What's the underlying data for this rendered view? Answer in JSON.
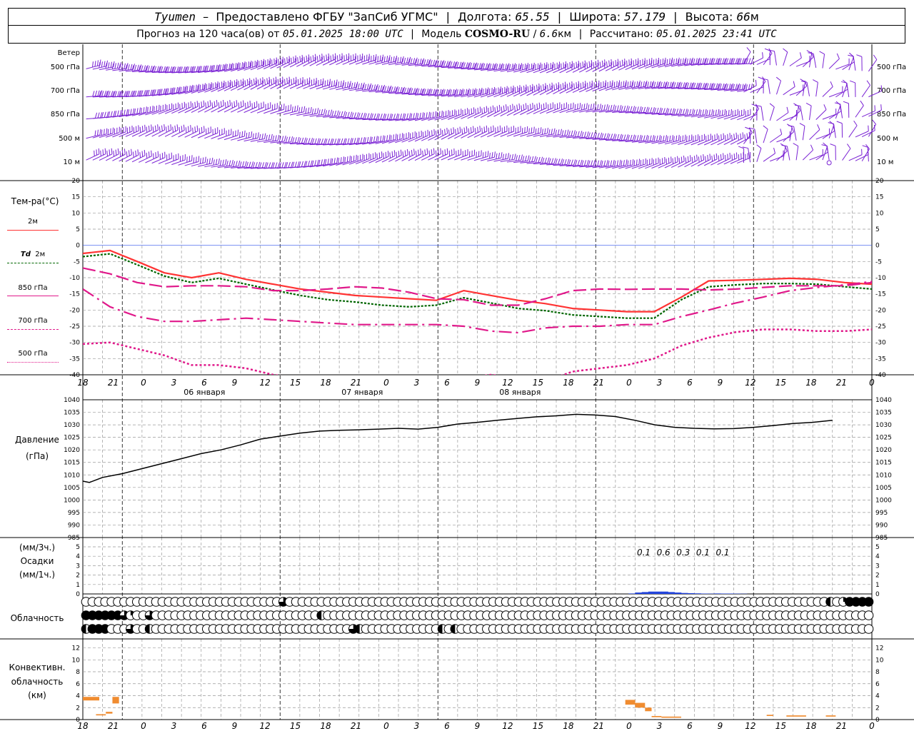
{
  "header": {
    "station": "Tyumen",
    "provider": "Предоставлено ФГБУ \"ЗапСиб УГМС\"",
    "lon_label": "Долгота:",
    "lon": "65.55",
    "lat_label": "Широта:",
    "lat": "57.179",
    "alt_label": "Высота:",
    "alt": "66",
    "alt_unit": "м",
    "forecast_prefix": "Прогноз на 120 часа(ов) от",
    "forecast_from": "05.01.2025 18:00 UTC",
    "model_label": "Модель",
    "model": "COSMO-RU",
    "resolution": "6.6",
    "res_unit": "км",
    "calc_label": "Рассчитано:",
    "calc_time": "05.01.2025 23:41 UTC"
  },
  "labels": {
    "wind": "Ветер",
    "wind_levels": [
      "500 гПа",
      "700 гПа",
      "850 гПа",
      "500 м",
      "10 м"
    ],
    "temp": "Тем-ра(°C)",
    "t2m": "2м",
    "td_sym": "Td",
    "td2m": "2м",
    "t850": "850 гПа",
    "t700": "700 гПа",
    "t500": "500 гПа",
    "pressure": "Давление",
    "pressure_unit": "(гПа)",
    "precip_unit3": "(мм/3ч.)",
    "precip": "Осадки",
    "precip_unit1": "(мм/1ч.)",
    "cloud": "Облачность",
    "conv1": "Конвективн.",
    "conv2": "облачность",
    "conv_unit": "(км)"
  },
  "colors": {
    "t2m": "#ff3333",
    "td2m": "#006600",
    "t_levels": "#e0188a",
    "pressure": "#000000",
    "precip": "#2244dd",
    "convective": "#f08c30",
    "wind": "#7a22d4",
    "zero_line": "#3355ee"
  },
  "chart_data": [
    {
      "type": "line",
      "title": "Тем-ра(°C)",
      "x_ticks": [
        "18",
        "21",
        "0",
        "3",
        "6",
        "9",
        "12",
        "15",
        "18",
        "21",
        "0",
        "3",
        "6",
        "9",
        "12",
        "15",
        "18",
        "21",
        "0",
        "3",
        "6",
        "9",
        "12",
        "15",
        "18",
        "21",
        "0"
      ],
      "day_labels": [
        "06 января",
        "07 января",
        "08 января"
      ],
      "x_hours": [
        0,
        3,
        6,
        9,
        12,
        15,
        18,
        21,
        24,
        27,
        30,
        33,
        36,
        39,
        42,
        45,
        48,
        51,
        54,
        57,
        60,
        63,
        66,
        69,
        72,
        75,
        78,
        81,
        84,
        87,
        90,
        93,
        96,
        99,
        102,
        105,
        108,
        111,
        114,
        117,
        120
      ],
      "ylim": [
        -40,
        20
      ],
      "yticks": [
        20,
        15,
        10,
        5,
        0,
        -5,
        -10,
        -15,
        -20,
        -25,
        -30,
        -35,
        -40
      ],
      "series": [
        {
          "name": "2м",
          "values": [
            -2.5,
            -1.6,
            -5,
            -8.5,
            -10,
            -8.5,
            -10.5,
            -12,
            -13.5,
            -14.5,
            -15.5,
            -16,
            -16.5,
            -17,
            -14,
            -15.5,
            -17,
            -18,
            -19.5,
            -20,
            -20.5,
            -20.5,
            -16,
            -11,
            -10.8,
            -10.5,
            -10.2,
            -10.5,
            -11.5,
            -12
          ]
        },
        {
          "name": "Td 2м",
          "values": [
            -3.5,
            -2.6,
            -6,
            -9.5,
            -11.5,
            -10.2,
            -12,
            -13.8,
            -15.5,
            -16.8,
            -17.5,
            -18.5,
            -19,
            -18.5,
            -16.2,
            -17.8,
            -19.5,
            -20.2,
            -21.5,
            -22,
            -22.5,
            -22.5,
            -16.8,
            -12.8,
            -12.2,
            -11.8,
            -11.8,
            -12,
            -12.8,
            -13.5
          ]
        },
        {
          "name": "850 гПа",
          "values": [
            -7,
            -8.8,
            -11.5,
            -12.8,
            -12.5,
            -12.5,
            -12.8,
            -14,
            -14,
            -13.5,
            -12.8,
            -13.2,
            -14.5,
            -16.5,
            -16.8,
            -18.5,
            -18.5,
            -16.5,
            -14,
            -13.5,
            -13.6,
            -13.5,
            -13.5,
            -13.8,
            -13.5,
            -13,
            -12.5,
            -12.5,
            -12.5,
            -11.5
          ]
        },
        {
          "name": "700 гПа",
          "values": [
            -13.5,
            -19,
            -22,
            -23.5,
            -23.5,
            -23,
            -22.5,
            -23,
            -23.5,
            -24,
            -24.5,
            -24.5,
            -24.5,
            -24.5,
            -25,
            -26.5,
            -27,
            -25.5,
            -25,
            -25,
            -24.5,
            -24.5,
            -22,
            -20,
            -17.8,
            -16,
            -14,
            -13,
            -12.2,
            -11.2
          ]
        },
        {
          "name": "500 гПа",
          "values": [
            -30.5,
            -30,
            -32,
            -34,
            -37,
            -37,
            -38,
            -40,
            -41,
            -42,
            -42,
            -42,
            -42,
            -42,
            -41,
            -40,
            -41,
            -42,
            -39,
            -38,
            -37,
            -35,
            -31,
            -28.5,
            -26.8,
            -26,
            -26,
            -26.5,
            -26.5,
            -26
          ]
        }
      ]
    },
    {
      "type": "line",
      "title": "Давление",
      "ylabel": "(гПа)",
      "ylim": [
        985,
        1040
      ],
      "yticks": [
        1040,
        1035,
        1030,
        1025,
        1020,
        1015,
        1010,
        1005,
        1000,
        995,
        990,
        985
      ],
      "x_hours": [
        0,
        1,
        2,
        3,
        6,
        9,
        12,
        15,
        18,
        21,
        24,
        27,
        30,
        33,
        36,
        39,
        42,
        45,
        48,
        51,
        54,
        57,
        60,
        63,
        66,
        69,
        72,
        75,
        78,
        81,
        84,
        87,
        90,
        93,
        96,
        99,
        102,
        105,
        108,
        111,
        114,
        117,
        120
      ],
      "series": [
        {
          "name": "Давление",
          "values": [
            1007.5,
            1007,
            1008,
            1009,
            1010.5,
            1012.5,
            1014.5,
            1016.5,
            1018.5,
            1020,
            1022,
            1024.3,
            1025.5,
            1026.7,
            1027.5,
            1027.8,
            1028,
            1028.3,
            1028.6,
            1028.3,
            1029,
            1030.3,
            1031,
            1031.8,
            1032.5,
            1033.2,
            1033.6,
            1034.2,
            1033.9,
            1033.3,
            1031.8,
            1030,
            1029,
            1028.6,
            1028.4,
            1028.5,
            1029,
            1029.7,
            1030.5,
            1031,
            1031.8
          ]
        }
      ]
    },
    {
      "type": "bar",
      "title": "Осадки",
      "ylim": [
        0,
        5
      ],
      "yticks": [
        5,
        4,
        3,
        2,
        1,
        0
      ],
      "totals_3h": [
        {
          "hour": 84,
          "value": "0.1"
        },
        {
          "hour": 87,
          "value": "0.6"
        },
        {
          "hour": 90,
          "value": "0.3"
        },
        {
          "hour": 93,
          "value": "0.1"
        },
        {
          "hour": 96,
          "value": "0.1"
        }
      ],
      "hourly_x": [
        83,
        84,
        85,
        86,
        87,
        88,
        89,
        90,
        91,
        92,
        93,
        94,
        95,
        96,
        97,
        98,
        99,
        100
      ],
      "hourly_values": [
        0.05,
        0.15,
        0.2,
        0.25,
        0.25,
        0.25,
        0.2,
        0.15,
        0.1,
        0.08,
        0.06,
        0.04,
        0.03,
        0.05,
        0.04,
        0.04,
        0.03,
        0.02
      ]
    },
    {
      "type": "table",
      "title": "Облачность",
      "rows": [
        "0000000000000000000000000000000300000000000000000000000000000000000000000000000000000000000000000000000000000000000002014444",
        "4444443100300000000000000000000000000200000000000000000000000000000000000000000000000000000000000000000000000000000000000000",
        "2444000300200000000000000000000000000000003200000000000020200000000000000000000000000000000000000000000000000000000000000000"
      ]
    },
    {
      "type": "bar",
      "title": "Конвективн. облачность",
      "ylabel": "(км)",
      "ylim": [
        0,
        13
      ],
      "yticks": [
        12,
        10,
        8,
        6,
        4,
        2,
        0
      ],
      "segments": [
        {
          "x0": 0,
          "x1": 2.5,
          "y0": 3.2,
          "y1": 3.8
        },
        {
          "x0": 2,
          "x1": 3.5,
          "y0": 0.7,
          "y1": 0.9
        },
        {
          "x0": 3.5,
          "x1": 4.5,
          "y0": 1.0,
          "y1": 1.3
        },
        {
          "x0": 4.5,
          "x1": 5.5,
          "y0": 2.7,
          "y1": 3.8
        },
        {
          "x0": 82.5,
          "x1": 84,
          "y0": 2.5,
          "y1": 3.3
        },
        {
          "x0": 84,
          "x1": 85.5,
          "y0": 2.0,
          "y1": 2.8
        },
        {
          "x0": 85.5,
          "x1": 86.5,
          "y0": 1.4,
          "y1": 2.0
        },
        {
          "x0": 86.5,
          "x1": 88,
          "y0": 0.4,
          "y1": 0.6
        },
        {
          "x0": 88,
          "x1": 91,
          "y0": 0.3,
          "y1": 0.5
        },
        {
          "x0": 104,
          "x1": 105,
          "y0": 0.6,
          "y1": 0.8
        },
        {
          "x0": 107,
          "x1": 110,
          "y0": 0.5,
          "y1": 0.7
        },
        {
          "x0": 113,
          "x1": 114.5,
          "y0": 0.5,
          "y1": 0.7
        }
      ]
    },
    {
      "type": "barbs",
      "title": "Ветер",
      "levels": [
        "500 гПа",
        "700 гПа",
        "850 гПа",
        "500 м",
        "10 м"
      ]
    }
  ]
}
